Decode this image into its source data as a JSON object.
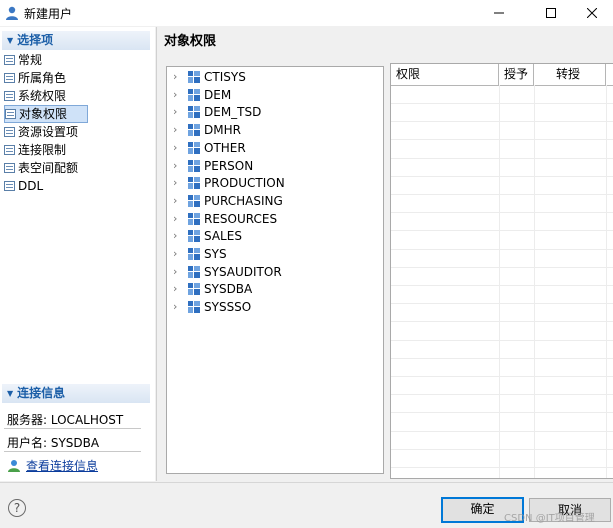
{
  "window": {
    "title": "新建用户",
    "icon": "user-icon"
  },
  "left_panel": {
    "options_header": "选择项",
    "nav_items": [
      {
        "label": "常规",
        "selected": false
      },
      {
        "label": "所属角色",
        "selected": false
      },
      {
        "label": "系统权限",
        "selected": false
      },
      {
        "label": "对象权限",
        "selected": true
      },
      {
        "label": "资源设置项",
        "selected": false
      },
      {
        "label": "连接限制",
        "selected": false
      },
      {
        "label": "表空间配额",
        "selected": false
      },
      {
        "label": "DDL",
        "selected": false
      }
    ],
    "connection_header": "连接信息",
    "server_label": "服务器: LOCALHOST",
    "username_label": "用户名: SYSDBA",
    "view_connection_link": "查看连接信息"
  },
  "main": {
    "title": "对象权限",
    "schemas": [
      "CTISYS",
      "DEM",
      "DEM_TSD",
      "DMHR",
      "OTHER",
      "PERSON",
      "PRODUCTION",
      "PURCHASING",
      "RESOURCES",
      "SALES",
      "SYS",
      "SYSAUDITOR",
      "SYSDBA",
      "SYSSSO"
    ],
    "grid_columns": [
      "权限",
      "授予",
      "转授"
    ]
  },
  "footer": {
    "ok_label": "确定",
    "cancel_label": "取消",
    "watermark": "CSDN @IT项目管理"
  },
  "colors": {
    "accent": "#0078d7",
    "section_header_text": "#1c5fa8",
    "selected_bg": "#cfe2f8",
    "link": "#0b3c9c"
  }
}
